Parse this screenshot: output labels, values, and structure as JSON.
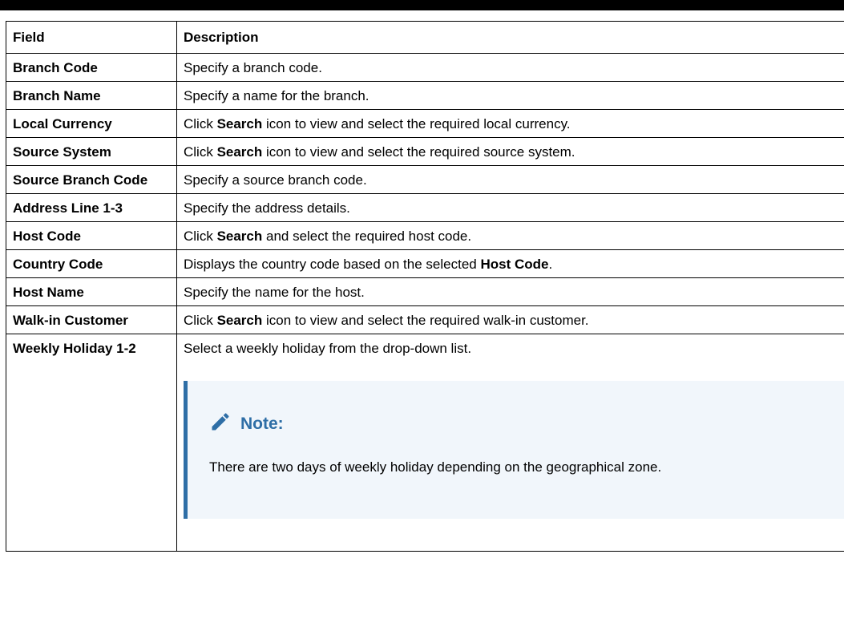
{
  "table": {
    "headers": [
      "Field",
      "Description"
    ],
    "rows": [
      {
        "field": "Branch Code",
        "desc": [
          "Specify a branch code."
        ]
      },
      {
        "field": "Branch Name",
        "desc": [
          "Specify a name for the branch."
        ]
      },
      {
        "field": "Local Currency",
        "desc": [
          "Click ",
          {
            "b": "Search"
          },
          " icon to view and select the required local currency."
        ]
      },
      {
        "field": "Source System",
        "desc": [
          "Click ",
          {
            "b": "Search"
          },
          " icon to view and select the required source system."
        ]
      },
      {
        "field": "Source Branch Code",
        "desc": [
          "Specify a source branch code."
        ]
      },
      {
        "field": "Address Line 1-3",
        "desc": [
          "Specify the address details."
        ]
      },
      {
        "field": "Host Code",
        "desc": [
          "Click ",
          {
            "b": "Search"
          },
          " and select the required host code."
        ]
      },
      {
        "field": "Country Code",
        "desc": [
          "Displays the country code based on the selected ",
          {
            "b": "Host Code"
          },
          "."
        ]
      },
      {
        "field": "Host Name",
        "desc": [
          "Specify the name for the host."
        ]
      },
      {
        "field": "Walk-in Customer",
        "desc": [
          "Click ",
          {
            "b": "Search"
          },
          " icon to view and select the required walk-in customer."
        ]
      },
      {
        "field": "Weekly Holiday 1-2",
        "desc": [
          "Select a weekly holiday from the drop-down list."
        ],
        "note": {
          "title": "Note:",
          "icon": "pencil-icon",
          "text": "There are two days of weekly holiday depending on the geographical zone."
        }
      }
    ]
  },
  "colors": {
    "accent": "#2e6ea6",
    "note_bg": "#f1f6fb"
  }
}
